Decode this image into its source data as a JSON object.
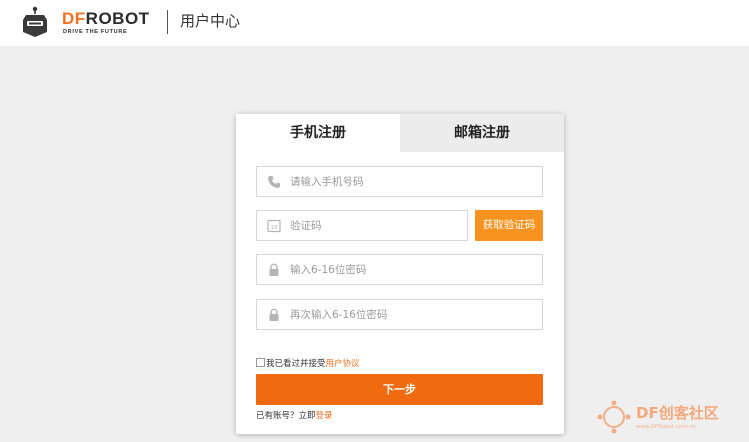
{
  "header": {
    "logo_df": "DF",
    "logo_robot": "ROBOT",
    "logo_tagline": "DRIVE THE FUTURE",
    "title": "用户中心"
  },
  "tabs": [
    {
      "label": "手机注册",
      "active": true
    },
    {
      "label": "邮箱注册",
      "active": false
    }
  ],
  "form": {
    "phone": {
      "placeholder": "请输入手机号码",
      "value": "",
      "icon": "phone-icon"
    },
    "code": {
      "placeholder": "验证码",
      "value": "",
      "icon": "verification-code-icon"
    },
    "get_code_label": "获取验证码",
    "password": {
      "placeholder": "输入6-16位密码",
      "value": "",
      "icon": "lock-icon"
    },
    "password_confirm": {
      "placeholder": "再次输入6-16位密码",
      "value": "",
      "icon": "lock-icon"
    },
    "agree_text": "我已看过并接受",
    "agree_link": "用户协议",
    "agree_checked": false,
    "next_label": "下一步",
    "have_account_text": "已有账号？立即",
    "login_link": "登录"
  },
  "watermark": {
    "brand": "DF创客社区",
    "url": "www.DFRobot.com.cn"
  },
  "colors": {
    "accent": "#f36f21",
    "get_code_button": "#f7931e",
    "next_button": "#f06a0f",
    "page_bg": "#efefef"
  }
}
